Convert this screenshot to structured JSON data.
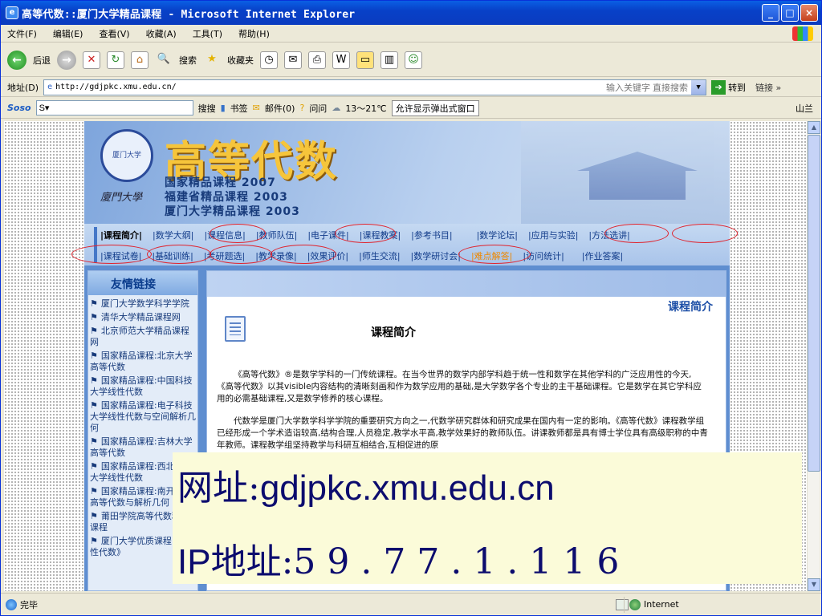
{
  "window": {
    "title": "高等代数::厦门大学精品课程 - Microsoft Internet Explorer",
    "minimize": "_",
    "maximize": "□",
    "close": "×"
  },
  "menubar": [
    "文件(F)",
    "编辑(E)",
    "查看(V)",
    "收藏(A)",
    "工具(T)",
    "帮助(H)"
  ],
  "toolbar": {
    "back": "后退",
    "search": "搜索",
    "favorites": "收藏夹"
  },
  "address": {
    "label": "地址(D)",
    "url": "http://gdjpkc.xmu.edu.cn/",
    "hint": "输入关键字 直接搜索",
    "go": "转到",
    "links": "链接 »"
  },
  "sosobar": {
    "brand": "Soso",
    "search_btn": "搜搜",
    "bookmarks": "书签",
    "mail": "邮件(0)",
    "ask": "问问",
    "weather": "13～21℃",
    "popup": "允许显示弹出式窗口",
    "region": "山兰"
  },
  "site": {
    "banner_title": "高等代数",
    "banner_lines": [
      "国家精品课程 2007",
      "福建省精品课程 2003",
      "厦门大学精品课程 2003"
    ],
    "seal_text": "厦门大学",
    "signature": "廈門大學",
    "nav_row1": [
      "|课程简介|",
      "|数学大纲|",
      "|课程信息|",
      "|教师队伍|",
      "|电子课件|",
      "|课程教案|",
      "|参考书目|",
      "|数学论坛|",
      "|应用与实验|",
      "|方法选讲|"
    ],
    "nav_row2": [
      "|课程试卷|",
      "|基础训练|",
      "|考研题选|",
      "|教学录像|",
      "|效果评价|",
      "|师生交流|",
      "|数学研讨会|",
      "|难点解答|",
      "|访问统计|",
      "|作业答案|"
    ],
    "sidebar_title": "友情链接",
    "sidebar_links": [
      "厦门大学数学科学学院",
      "清华大学精品课程网",
      "北京师范大学精品课程网",
      "国家精品课程:北京大学高等代数",
      "国家精品课程:中国科技大学线性代数",
      "国家精品课程:电子科技大学线性代数与空间解析几何",
      "国家精品课程:吉林大学高等代数",
      "国家精品课程:西北工业大学线性代数",
      "国家精品课程:南开大学高等代数与解析几何",
      "莆田学院高等代数精品课程",
      "厦门大学优质课程:《线性代数》"
    ],
    "main_tag": "课程简介",
    "main_title": "课程简介",
    "para1": "《高等代数》®是数学学科的一门传统课程。在当今世界的数学内部学科趋于统一性和数学在其他学科的广泛应用性的今天,《高等代数》以其visible内容结构的清晰刻画和作为数学应用的基础,是大学数学各个专业的主干基础课程。它是数学在其它学科应用的必需基础课程,又是数学修养的核心课程。",
    "para2": "代数学是厦门大学数学科学学院的重要研究方向之一,代数学研究群体和研究成果在国内有一定的影响。《高等代数》课程教学组已经形成一个学术造诣较高,结构合理,人员稳定,教学水平高,教学效果好的教师队伍。讲课教师都是具有博士学位具有高级职称的中青年教师。课程教学组坚持教学与科研互相结合,互相促进的原"
  },
  "overlay": {
    "url_label": "网址:",
    "url_value": "gdjpkc.xmu.edu.cn",
    "ip_prefix": "IP",
    "ip_label": "地址:",
    "ip_value": "59.77.1.116"
  },
  "status": {
    "text": "完毕",
    "zone": "Internet"
  },
  "colors": {
    "xp_blue": "#0841c8",
    "oval_red": "#e0222c",
    "overlay_bg": "#fbfbd9",
    "overlay_text": "#0c0c6e"
  }
}
